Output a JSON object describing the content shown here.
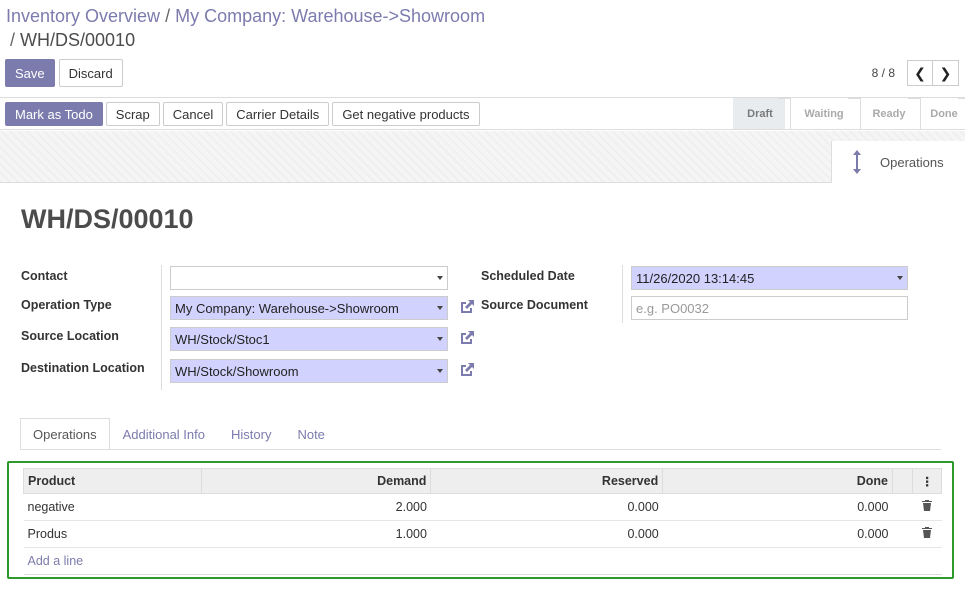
{
  "breadcrumb": {
    "root": "Inventory Overview",
    "parent": "My Company: Warehouse->Showroom",
    "current": "WH/DS/00010",
    "separator": "/"
  },
  "actions": {
    "save": "Save",
    "discard": "Discard"
  },
  "pager": {
    "value": "8 / 8"
  },
  "status_buttons": [
    "Mark as Todo",
    "Scrap",
    "Cancel",
    "Carrier Details",
    "Get negative products"
  ],
  "stages": [
    {
      "label": "Draft",
      "active": true
    },
    {
      "label": "Waiting",
      "active": false
    },
    {
      "label": "Ready",
      "active": false
    },
    {
      "label": "Done",
      "active": false
    }
  ],
  "smart_button": {
    "label": "Operations",
    "icon": "arrows-v-icon"
  },
  "record": {
    "title": "WH/DS/00010",
    "labels": {
      "contact": "Contact",
      "operation_type": "Operation Type",
      "source_location": "Source Location",
      "destination_location": "Destination Location",
      "scheduled_date": "Scheduled Date",
      "source_document": "Source Document"
    },
    "values": {
      "contact": "",
      "operation_type": "My Company: Warehouse->Showroom",
      "source_location": "WH/Stock/Stoc1",
      "destination_location": "WH/Stock/Showroom",
      "scheduled_date": "11/26/2020 13:14:45",
      "source_document": ""
    },
    "placeholders": {
      "source_document": "e.g. PO0032"
    }
  },
  "tabs": [
    "Operations",
    "Additional Info",
    "History",
    "Note"
  ],
  "table": {
    "columns": [
      "Product",
      "Demand",
      "Reserved",
      "Done"
    ],
    "rows": [
      {
        "product": "negative",
        "demand": "2.000",
        "reserved": "0.000",
        "done": "0.000"
      },
      {
        "product": "Produs",
        "demand": "1.000",
        "reserved": "0.000",
        "done": "0.000"
      }
    ],
    "add_line": "Add a line"
  },
  "colors": {
    "accent": "#7c7bad",
    "required_bg": "#d2d2ff",
    "highlight_border": "#2e9a2e"
  }
}
